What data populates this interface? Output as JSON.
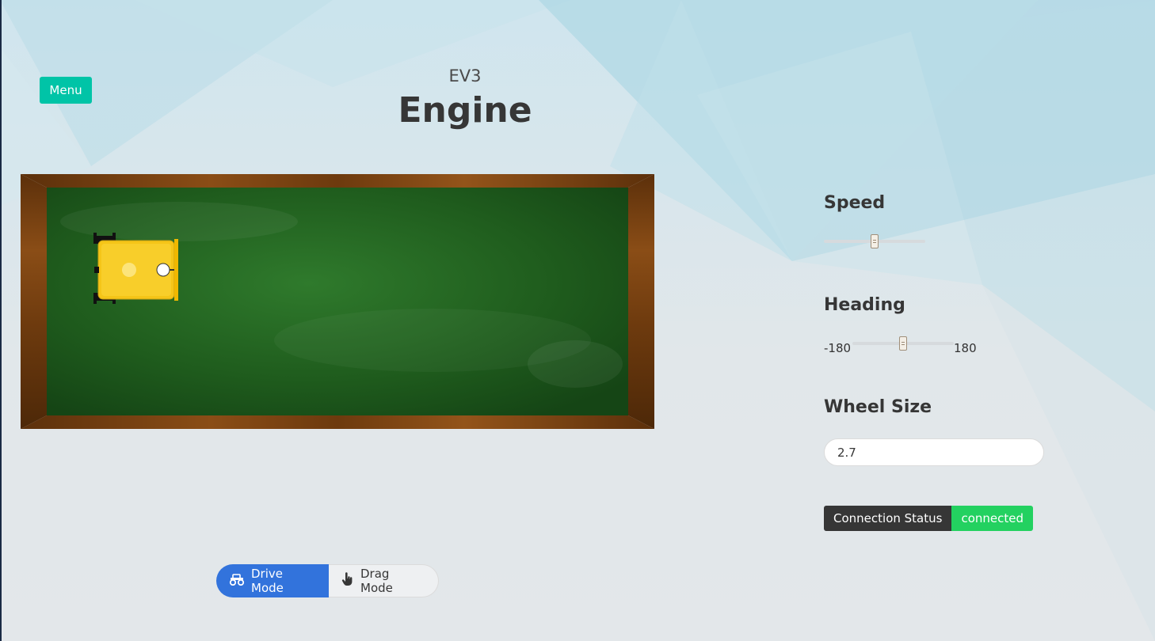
{
  "header": {
    "menu_label": "Menu",
    "subtitle": "EV3",
    "title": "Engine"
  },
  "controls": {
    "speed": {
      "label": "Speed",
      "value_fraction": 0.5
    },
    "heading": {
      "label": "Heading",
      "min_label": "-180",
      "max_label": "180",
      "value_fraction": 0.5
    },
    "wheel_size": {
      "label": "Wheel Size",
      "value": "2.7"
    }
  },
  "status": {
    "label": "Connection Status",
    "value": "connected",
    "value_color": "#23d160"
  },
  "modes": {
    "drive_label": "Drive Mode",
    "drag_label": "Drag Mode",
    "active": "drive"
  },
  "colors": {
    "accent": "#00c4a7",
    "primary": "#3273dc",
    "board_green": "#1e5a1e",
    "frame_wood": "#7a4210",
    "robot_yellow": "#f5c518"
  },
  "icons": {
    "drive": "monster-truck-icon",
    "drag": "hand-pointer-icon"
  }
}
